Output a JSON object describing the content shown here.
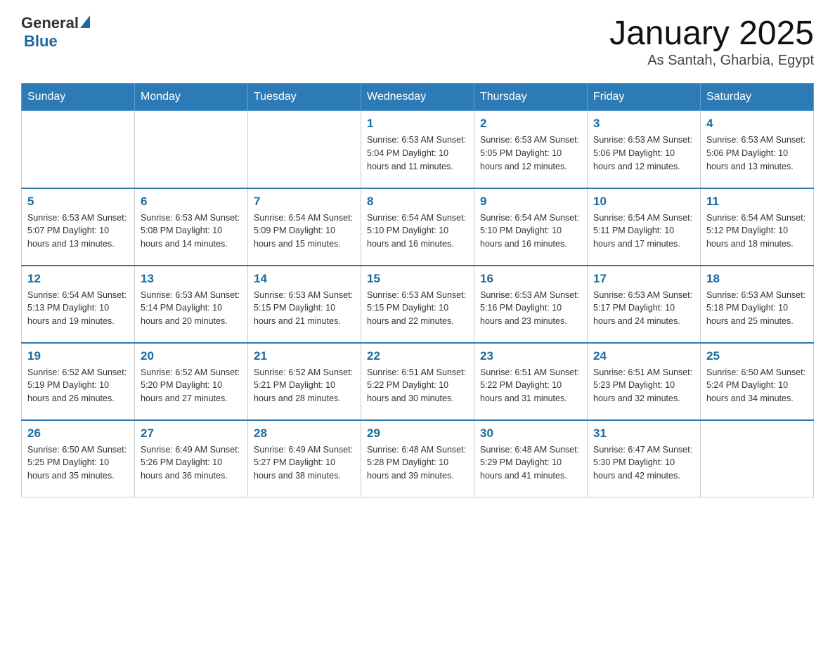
{
  "header": {
    "logo": {
      "general": "General",
      "blue": "Blue"
    },
    "title": "January 2025",
    "location": "As Santah, Gharbia, Egypt"
  },
  "weekdays": [
    "Sunday",
    "Monday",
    "Tuesday",
    "Wednesday",
    "Thursday",
    "Friday",
    "Saturday"
  ],
  "weeks": [
    [
      {
        "day": "",
        "info": ""
      },
      {
        "day": "",
        "info": ""
      },
      {
        "day": "",
        "info": ""
      },
      {
        "day": "1",
        "info": "Sunrise: 6:53 AM\nSunset: 5:04 PM\nDaylight: 10 hours\nand 11 minutes."
      },
      {
        "day": "2",
        "info": "Sunrise: 6:53 AM\nSunset: 5:05 PM\nDaylight: 10 hours\nand 12 minutes."
      },
      {
        "day": "3",
        "info": "Sunrise: 6:53 AM\nSunset: 5:06 PM\nDaylight: 10 hours\nand 12 minutes."
      },
      {
        "day": "4",
        "info": "Sunrise: 6:53 AM\nSunset: 5:06 PM\nDaylight: 10 hours\nand 13 minutes."
      }
    ],
    [
      {
        "day": "5",
        "info": "Sunrise: 6:53 AM\nSunset: 5:07 PM\nDaylight: 10 hours\nand 13 minutes."
      },
      {
        "day": "6",
        "info": "Sunrise: 6:53 AM\nSunset: 5:08 PM\nDaylight: 10 hours\nand 14 minutes."
      },
      {
        "day": "7",
        "info": "Sunrise: 6:54 AM\nSunset: 5:09 PM\nDaylight: 10 hours\nand 15 minutes."
      },
      {
        "day": "8",
        "info": "Sunrise: 6:54 AM\nSunset: 5:10 PM\nDaylight: 10 hours\nand 16 minutes."
      },
      {
        "day": "9",
        "info": "Sunrise: 6:54 AM\nSunset: 5:10 PM\nDaylight: 10 hours\nand 16 minutes."
      },
      {
        "day": "10",
        "info": "Sunrise: 6:54 AM\nSunset: 5:11 PM\nDaylight: 10 hours\nand 17 minutes."
      },
      {
        "day": "11",
        "info": "Sunrise: 6:54 AM\nSunset: 5:12 PM\nDaylight: 10 hours\nand 18 minutes."
      }
    ],
    [
      {
        "day": "12",
        "info": "Sunrise: 6:54 AM\nSunset: 5:13 PM\nDaylight: 10 hours\nand 19 minutes."
      },
      {
        "day": "13",
        "info": "Sunrise: 6:53 AM\nSunset: 5:14 PM\nDaylight: 10 hours\nand 20 minutes."
      },
      {
        "day": "14",
        "info": "Sunrise: 6:53 AM\nSunset: 5:15 PM\nDaylight: 10 hours\nand 21 minutes."
      },
      {
        "day": "15",
        "info": "Sunrise: 6:53 AM\nSunset: 5:15 PM\nDaylight: 10 hours\nand 22 minutes."
      },
      {
        "day": "16",
        "info": "Sunrise: 6:53 AM\nSunset: 5:16 PM\nDaylight: 10 hours\nand 23 minutes."
      },
      {
        "day": "17",
        "info": "Sunrise: 6:53 AM\nSunset: 5:17 PM\nDaylight: 10 hours\nand 24 minutes."
      },
      {
        "day": "18",
        "info": "Sunrise: 6:53 AM\nSunset: 5:18 PM\nDaylight: 10 hours\nand 25 minutes."
      }
    ],
    [
      {
        "day": "19",
        "info": "Sunrise: 6:52 AM\nSunset: 5:19 PM\nDaylight: 10 hours\nand 26 minutes."
      },
      {
        "day": "20",
        "info": "Sunrise: 6:52 AM\nSunset: 5:20 PM\nDaylight: 10 hours\nand 27 minutes."
      },
      {
        "day": "21",
        "info": "Sunrise: 6:52 AM\nSunset: 5:21 PM\nDaylight: 10 hours\nand 28 minutes."
      },
      {
        "day": "22",
        "info": "Sunrise: 6:51 AM\nSunset: 5:22 PM\nDaylight: 10 hours\nand 30 minutes."
      },
      {
        "day": "23",
        "info": "Sunrise: 6:51 AM\nSunset: 5:22 PM\nDaylight: 10 hours\nand 31 minutes."
      },
      {
        "day": "24",
        "info": "Sunrise: 6:51 AM\nSunset: 5:23 PM\nDaylight: 10 hours\nand 32 minutes."
      },
      {
        "day": "25",
        "info": "Sunrise: 6:50 AM\nSunset: 5:24 PM\nDaylight: 10 hours\nand 34 minutes."
      }
    ],
    [
      {
        "day": "26",
        "info": "Sunrise: 6:50 AM\nSunset: 5:25 PM\nDaylight: 10 hours\nand 35 minutes."
      },
      {
        "day": "27",
        "info": "Sunrise: 6:49 AM\nSunset: 5:26 PM\nDaylight: 10 hours\nand 36 minutes."
      },
      {
        "day": "28",
        "info": "Sunrise: 6:49 AM\nSunset: 5:27 PM\nDaylight: 10 hours\nand 38 minutes."
      },
      {
        "day": "29",
        "info": "Sunrise: 6:48 AM\nSunset: 5:28 PM\nDaylight: 10 hours\nand 39 minutes."
      },
      {
        "day": "30",
        "info": "Sunrise: 6:48 AM\nSunset: 5:29 PM\nDaylight: 10 hours\nand 41 minutes."
      },
      {
        "day": "31",
        "info": "Sunrise: 6:47 AM\nSunset: 5:30 PM\nDaylight: 10 hours\nand 42 minutes."
      },
      {
        "day": "",
        "info": ""
      }
    ]
  ]
}
